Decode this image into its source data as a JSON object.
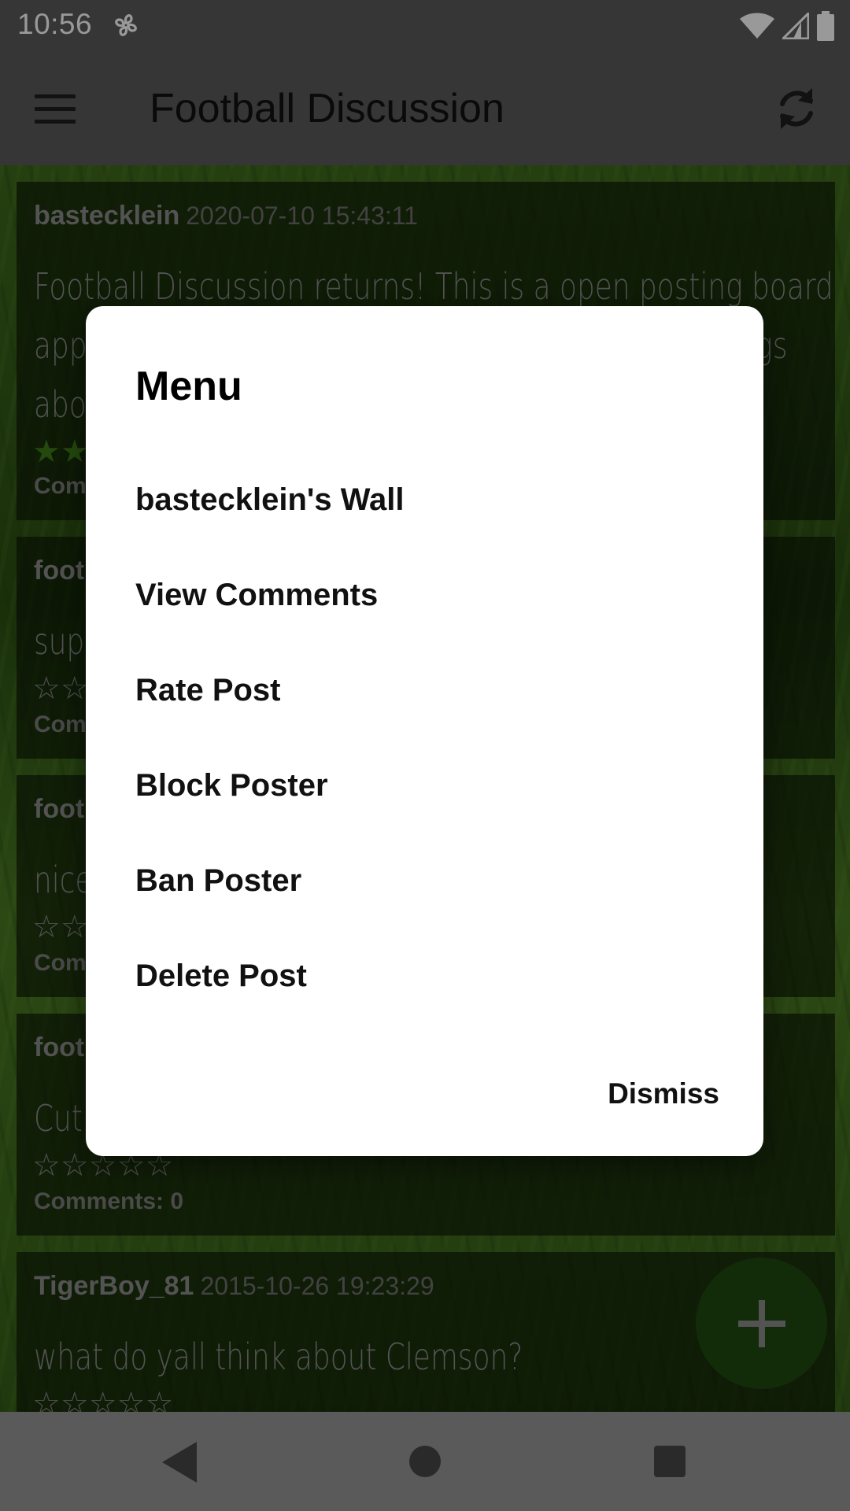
{
  "status_bar": {
    "time": "10:56",
    "icons": [
      "fan-icon",
      "wifi-icon",
      "cell-signal-icon",
      "battery-icon"
    ]
  },
  "app_bar": {
    "title": "Football Discussion",
    "left_icon": "menu-icon",
    "right_icon": "refresh-icon"
  },
  "posts": [
    {
      "author": "bastecklein",
      "date": "2020-07-10 15:43:11",
      "body": "Football Discussion returns! This is a open posting board app for discussing football. You can post about things about",
      "stars": "★★",
      "comments": "Comm"
    },
    {
      "author": "foot",
      "date": "",
      "body": "sup",
      "stars": "☆☆",
      "comments": "Com"
    },
    {
      "author": "foot",
      "date": "",
      "body": "nice",
      "stars": "☆☆",
      "comments": "Com"
    },
    {
      "author": "foot",
      "date": "",
      "body": "Cutl",
      "stars": "☆☆☆☆☆",
      "comments": "Comments: 0"
    },
    {
      "author": "TigerBoy_81",
      "date": "2015-10-26 19:23:29",
      "body": "what do yall think about Clemson?",
      "stars": "☆☆☆☆☆",
      "comments": ""
    }
  ],
  "dialog": {
    "title": "Menu",
    "items": [
      "bastecklein's Wall",
      "View Comments",
      "Rate Post",
      "Block Poster",
      "Ban Poster",
      "Delete Post"
    ],
    "dismiss_label": "Dismiss"
  },
  "fab": {
    "icon": "plus-icon"
  },
  "nav_bar": {
    "icons": [
      "back-icon",
      "home-icon",
      "recents-icon"
    ]
  },
  "colors": {
    "bars": "#5a5a5a",
    "fab": "#1f4a0f",
    "dialog": "#ffffff",
    "star_filled": "#3c7a18"
  }
}
